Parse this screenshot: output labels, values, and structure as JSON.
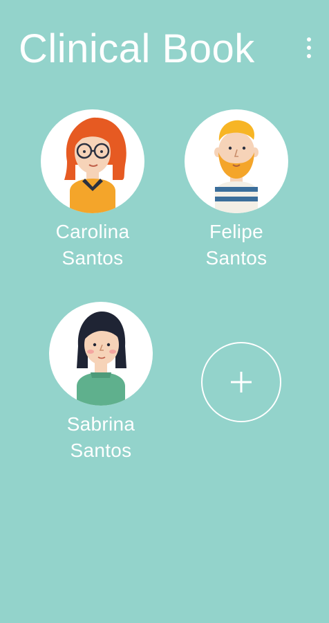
{
  "header": {
    "title": "Clinical Book",
    "menu_icon": "more-vert-icon"
  },
  "profiles": [
    {
      "first_name": "Carolina",
      "last_name": "Santos",
      "avatar_icon": "woman-glasses-avatar-icon"
    },
    {
      "first_name": "Felipe",
      "last_name": "Santos",
      "avatar_icon": "bearded-man-avatar-icon"
    },
    {
      "first_name": "Sabrina",
      "last_name": "Santos",
      "avatar_icon": "girl-bob-avatar-icon"
    }
  ],
  "add_profile": {
    "icon": "plus-icon"
  },
  "colors": {
    "background": "#93d3cb",
    "text": "#ffffff"
  }
}
